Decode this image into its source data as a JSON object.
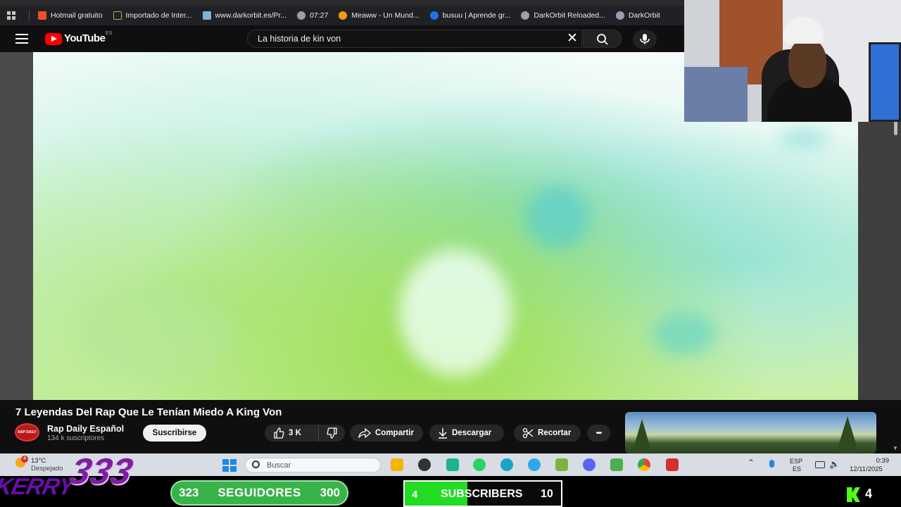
{
  "browser": {
    "bookmarks": [
      {
        "label": "Hotmail gratuito",
        "color": "#f25022"
      },
      {
        "label": "Importado de Inter...",
        "color": "#c8a25a"
      },
      {
        "label": "www.darkorbit.es/Pr...",
        "color": "#7fb3d5"
      },
      {
        "label": "07:27",
        "color": "#9aa0a6"
      },
      {
        "label": "Meaww - Un Mund...",
        "color": "#f39c12"
      },
      {
        "label": "busuu | Aprende gr...",
        "color": "#1a73e8"
      },
      {
        "label": "DarkOrbit Reloaded...",
        "color": "#9aa0a6"
      },
      {
        "label": "DarkOrbit",
        "color": "#9aa0a6"
      }
    ]
  },
  "youtube": {
    "logo_text": "YouTube",
    "country_code": "ES",
    "search_value": "La historia de kin von",
    "clear_symbol": "✕",
    "video_title": "7 Leyendas Del Rap Que Le Tenían Miedo A King Von",
    "channel_name": "Rap Daily Español",
    "channel_subs": "134 k suscriptores",
    "avatar_text": "RAP DAILY",
    "subscribe_label": "Suscribirse",
    "like_count": "3 K",
    "share_label": "Compartir",
    "download_label": "Descargar",
    "clip_label": "Recortar",
    "more_symbol": "•••"
  },
  "taskbar": {
    "weather_badge": "4",
    "weather_temp": "13°C",
    "weather_cond": "Despejado",
    "search_placeholder": "Buscar",
    "lang_top": "ESP",
    "lang_bottom": "ES",
    "time": "0:39",
    "date": "12/11/2025"
  },
  "overlay": {
    "brand_name": "KERRY",
    "brand_number": "333",
    "followers_current": "323",
    "followers_label": "SEGUIDORES",
    "followers_goal": "300",
    "subs_current": "4",
    "subs_label": "SUBSCRIBERS",
    "subs_goal": "10",
    "kick_count": "4",
    "subs_progress": 0.4,
    "colors": {
      "followers_bar": "#38b349",
      "subs_fill": "#22dd22",
      "kick_green": "#53fc18"
    }
  }
}
